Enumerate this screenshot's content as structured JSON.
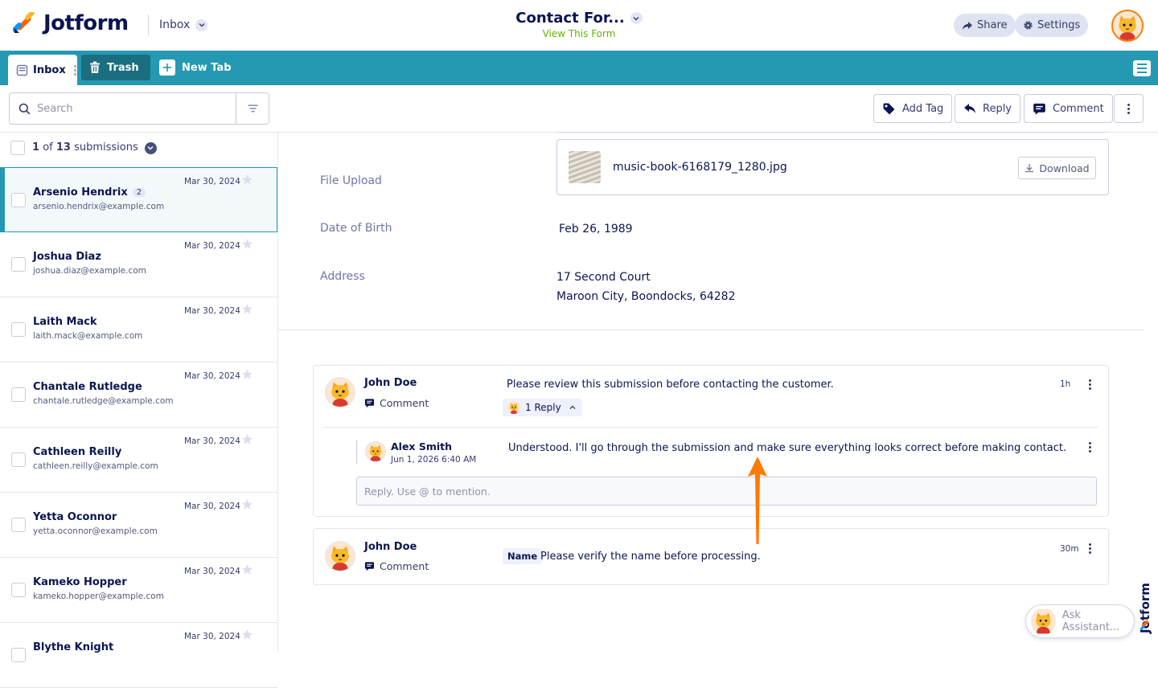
{
  "header": {
    "brand": "Jotform",
    "inbox_label": "Inbox",
    "form_title": "Contact For...",
    "view_form_label": "View This Form",
    "share_label": "Share",
    "settings_label": "Settings"
  },
  "tabs": {
    "inbox": "Inbox",
    "trash": "Trash",
    "new_tab": "New Tab"
  },
  "toolbar": {
    "search_placeholder": "Search",
    "add_tag_label": "Add Tag",
    "reply_label": "Reply",
    "comment_label": "Comment"
  },
  "selection": {
    "current": "1",
    "of_label": "of",
    "total": "13",
    "unit": "submissions"
  },
  "submissions": [
    {
      "name": "Arsenio Hendrix",
      "email": "arsenio.hendrix@example.com",
      "date": "Mar 30, 2024",
      "badge": "2",
      "active": true
    },
    {
      "name": "Joshua Diaz",
      "email": "joshua.diaz@example.com",
      "date": "Mar 30, 2024"
    },
    {
      "name": "Laith Mack",
      "email": "laith.mack@example.com",
      "date": "Mar 30, 2024"
    },
    {
      "name": "Chantale Rutledge",
      "email": "chantale.rutledge@example.com",
      "date": "Mar 30, 2024"
    },
    {
      "name": "Cathleen Reilly",
      "email": "cathleen.reilly@example.com",
      "date": "Mar 30, 2024"
    },
    {
      "name": "Yetta Oconnor",
      "email": "yetta.oconnor@example.com",
      "date": "Mar 30, 2024"
    },
    {
      "name": "Kameko Hopper",
      "email": "kameko.hopper@example.com",
      "date": "Mar 30, 2024"
    },
    {
      "name": "Blythe Knight",
      "email": "",
      "date": "Mar 30, 2024"
    }
  ],
  "details": {
    "file_upload_label": "File Upload",
    "file_name": "music-book-6168179_1280.jpg",
    "download_label": "Download",
    "dob_label": "Date of Birth",
    "dob_value": "Feb 26, 1989",
    "address_label": "Address",
    "address_line1": "17 Second Court",
    "address_line2": "Maroon City, Boondocks, 64282"
  },
  "comments": [
    {
      "author": "John Doe",
      "type": "Comment",
      "text": "Please review this submission before contacting the customer.",
      "time": "1h",
      "reply_count_label": "1 Reply",
      "reply": {
        "author": "Alex Smith",
        "date": "Jun 1, 2026 6:40 AM",
        "text": "Understood. I'll go through the submission and make sure everything looks correct before making contact."
      },
      "reply_placeholder": "Reply. Use @ to mention."
    },
    {
      "author": "John Doe",
      "type": "Comment",
      "tag": "Name",
      "text": "Please verify the name before processing.",
      "time": "30m"
    }
  ],
  "assistant": {
    "label": "Ask Assistant..."
  },
  "side_brand": "Jotform",
  "colors": {
    "navy": "#0a1551",
    "teal": "#2598b2",
    "green": "#64b200",
    "arrow": "#ff7a00"
  },
  "icons": [
    "jotform-logo-icon",
    "chevron-down-icon",
    "share-icon",
    "gear-icon",
    "avatar-icon",
    "inbox-icon",
    "trash-icon",
    "plus-icon",
    "hamburger-menu-icon",
    "search-icon",
    "filter-icon",
    "tag-icon",
    "reply-icon",
    "comment-icon",
    "kebab-icon",
    "star-icon",
    "download-icon",
    "chevron-up-icon"
  ]
}
